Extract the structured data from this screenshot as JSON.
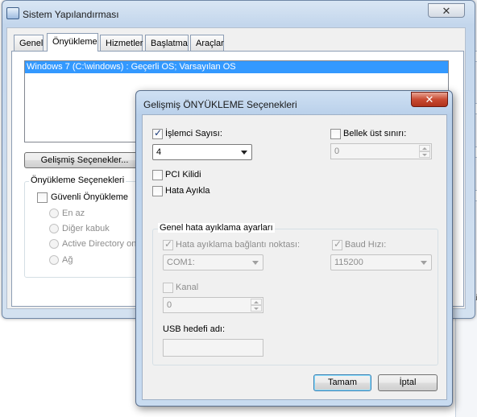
{
  "background_window": {
    "right_edge_text": [
      "i",
      "Ki"
    ]
  },
  "main_window": {
    "title": "Sistem Yapılandırması",
    "close_glyph": "✕",
    "tabs": [
      {
        "label": "Genel"
      },
      {
        "label": "Önyükleme"
      },
      {
        "label": "Hizmetler"
      },
      {
        "label": "Başlatma"
      },
      {
        "label": "Araçlar"
      }
    ],
    "os_entries": [
      "Windows 7 (C:\\windows) : Geçerli OS; Varsayılan OS"
    ],
    "advanced_button": "Gelişmiş Seçenekler...",
    "boot_options_group": "Önyükleme Seçenekleri",
    "safe_boot": "Güvenli Önyükleme",
    "safe_boot_options": [
      "En az",
      "Diğer kabuk",
      "Active Directory onarımı",
      "Ağ"
    ]
  },
  "dialog": {
    "title": "Gelişmiş ÖNYÜKLEME Seçenekleri",
    "close_glyph": "✕",
    "num_processors_label": "İşlemci Sayısı:",
    "num_processors_checked": true,
    "num_processors_value": "4",
    "max_memory_label": "Bellek üst sınırı:",
    "max_memory_checked": false,
    "max_memory_value": "0",
    "pci_lock_label": "PCI Kilidi",
    "debug_label": "Hata Ayıkla",
    "debug_group_label": "Genel hata ayıklama ayarları",
    "debug_port_label": "Hata ayıklama bağlantı noktası:",
    "debug_port_value": "COM1:",
    "baud_rate_label": "Baud Hızı:",
    "baud_rate_value": "115200",
    "channel_label": "Kanal",
    "channel_value": "0",
    "usb_target_label": "USB hedefi adı:",
    "usb_target_value": "",
    "ok_button": "Tamam",
    "cancel_button": "İptal"
  }
}
